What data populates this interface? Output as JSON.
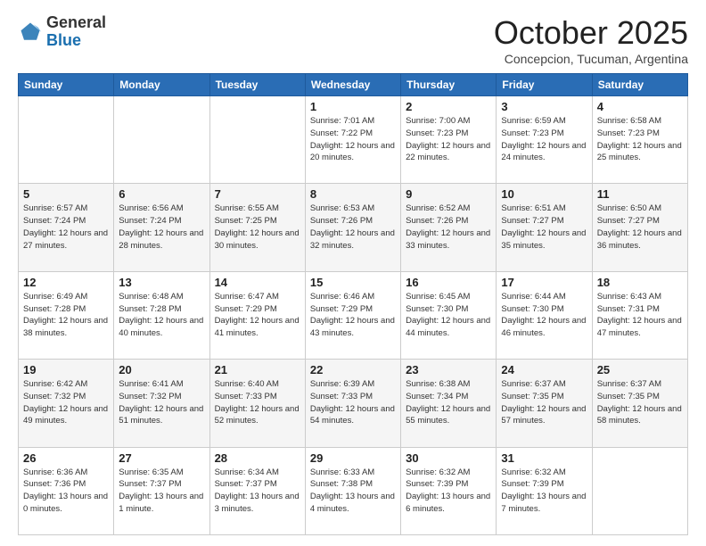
{
  "header": {
    "logo_general": "General",
    "logo_blue": "Blue",
    "month": "October 2025",
    "location": "Concepcion, Tucuman, Argentina"
  },
  "weekdays": [
    "Sunday",
    "Monday",
    "Tuesday",
    "Wednesday",
    "Thursday",
    "Friday",
    "Saturday"
  ],
  "weeks": [
    [
      {
        "day": "",
        "info": ""
      },
      {
        "day": "",
        "info": ""
      },
      {
        "day": "",
        "info": ""
      },
      {
        "day": "1",
        "info": "Sunrise: 7:01 AM\nSunset: 7:22 PM\nDaylight: 12 hours\nand 20 minutes."
      },
      {
        "day": "2",
        "info": "Sunrise: 7:00 AM\nSunset: 7:23 PM\nDaylight: 12 hours\nand 22 minutes."
      },
      {
        "day": "3",
        "info": "Sunrise: 6:59 AM\nSunset: 7:23 PM\nDaylight: 12 hours\nand 24 minutes."
      },
      {
        "day": "4",
        "info": "Sunrise: 6:58 AM\nSunset: 7:23 PM\nDaylight: 12 hours\nand 25 minutes."
      }
    ],
    [
      {
        "day": "5",
        "info": "Sunrise: 6:57 AM\nSunset: 7:24 PM\nDaylight: 12 hours\nand 27 minutes."
      },
      {
        "day": "6",
        "info": "Sunrise: 6:56 AM\nSunset: 7:24 PM\nDaylight: 12 hours\nand 28 minutes."
      },
      {
        "day": "7",
        "info": "Sunrise: 6:55 AM\nSunset: 7:25 PM\nDaylight: 12 hours\nand 30 minutes."
      },
      {
        "day": "8",
        "info": "Sunrise: 6:53 AM\nSunset: 7:26 PM\nDaylight: 12 hours\nand 32 minutes."
      },
      {
        "day": "9",
        "info": "Sunrise: 6:52 AM\nSunset: 7:26 PM\nDaylight: 12 hours\nand 33 minutes."
      },
      {
        "day": "10",
        "info": "Sunrise: 6:51 AM\nSunset: 7:27 PM\nDaylight: 12 hours\nand 35 minutes."
      },
      {
        "day": "11",
        "info": "Sunrise: 6:50 AM\nSunset: 7:27 PM\nDaylight: 12 hours\nand 36 minutes."
      }
    ],
    [
      {
        "day": "12",
        "info": "Sunrise: 6:49 AM\nSunset: 7:28 PM\nDaylight: 12 hours\nand 38 minutes."
      },
      {
        "day": "13",
        "info": "Sunrise: 6:48 AM\nSunset: 7:28 PM\nDaylight: 12 hours\nand 40 minutes."
      },
      {
        "day": "14",
        "info": "Sunrise: 6:47 AM\nSunset: 7:29 PM\nDaylight: 12 hours\nand 41 minutes."
      },
      {
        "day": "15",
        "info": "Sunrise: 6:46 AM\nSunset: 7:29 PM\nDaylight: 12 hours\nand 43 minutes."
      },
      {
        "day": "16",
        "info": "Sunrise: 6:45 AM\nSunset: 7:30 PM\nDaylight: 12 hours\nand 44 minutes."
      },
      {
        "day": "17",
        "info": "Sunrise: 6:44 AM\nSunset: 7:30 PM\nDaylight: 12 hours\nand 46 minutes."
      },
      {
        "day": "18",
        "info": "Sunrise: 6:43 AM\nSunset: 7:31 PM\nDaylight: 12 hours\nand 47 minutes."
      }
    ],
    [
      {
        "day": "19",
        "info": "Sunrise: 6:42 AM\nSunset: 7:32 PM\nDaylight: 12 hours\nand 49 minutes."
      },
      {
        "day": "20",
        "info": "Sunrise: 6:41 AM\nSunset: 7:32 PM\nDaylight: 12 hours\nand 51 minutes."
      },
      {
        "day": "21",
        "info": "Sunrise: 6:40 AM\nSunset: 7:33 PM\nDaylight: 12 hours\nand 52 minutes."
      },
      {
        "day": "22",
        "info": "Sunrise: 6:39 AM\nSunset: 7:33 PM\nDaylight: 12 hours\nand 54 minutes."
      },
      {
        "day": "23",
        "info": "Sunrise: 6:38 AM\nSunset: 7:34 PM\nDaylight: 12 hours\nand 55 minutes."
      },
      {
        "day": "24",
        "info": "Sunrise: 6:37 AM\nSunset: 7:35 PM\nDaylight: 12 hours\nand 57 minutes."
      },
      {
        "day": "25",
        "info": "Sunrise: 6:37 AM\nSunset: 7:35 PM\nDaylight: 12 hours\nand 58 minutes."
      }
    ],
    [
      {
        "day": "26",
        "info": "Sunrise: 6:36 AM\nSunset: 7:36 PM\nDaylight: 13 hours\nand 0 minutes."
      },
      {
        "day": "27",
        "info": "Sunrise: 6:35 AM\nSunset: 7:37 PM\nDaylight: 13 hours\nand 1 minute."
      },
      {
        "day": "28",
        "info": "Sunrise: 6:34 AM\nSunset: 7:37 PM\nDaylight: 13 hours\nand 3 minutes."
      },
      {
        "day": "29",
        "info": "Sunrise: 6:33 AM\nSunset: 7:38 PM\nDaylight: 13 hours\nand 4 minutes."
      },
      {
        "day": "30",
        "info": "Sunrise: 6:32 AM\nSunset: 7:39 PM\nDaylight: 13 hours\nand 6 minutes."
      },
      {
        "day": "31",
        "info": "Sunrise: 6:32 AM\nSunset: 7:39 PM\nDaylight: 13 hours\nand 7 minutes."
      },
      {
        "day": "",
        "info": ""
      }
    ]
  ]
}
